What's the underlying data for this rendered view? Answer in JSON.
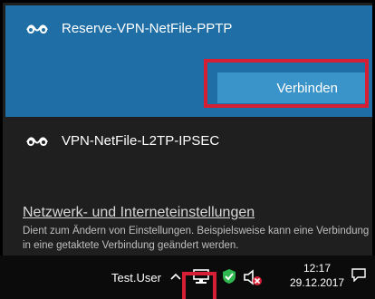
{
  "vpn": {
    "selected": {
      "name": "Reserve-VPN-NetFile-PPTP",
      "connect_label": "Verbinden"
    },
    "items": [
      {
        "name": "VPN-NetFile-L2TP-IPSEC"
      }
    ]
  },
  "settings": {
    "link": "Netzwerk- und Interneteinstellungen",
    "description": "Dient zum Ändern von Einstellungen. Beispielsweise kann eine Verbindung in eine getaktete Verbindung geändert werden."
  },
  "taskbar": {
    "user": "Test.User",
    "time": "12:17",
    "date": "29.12.2017"
  },
  "colors": {
    "accent": "#1f6fa6",
    "button": "#3a94c9",
    "highlight_red": "#d61f35",
    "panel_bg": "#1f1f1f"
  },
  "icons": [
    "vpn-icon",
    "chevron-up-icon",
    "network-icon",
    "defender-shield-icon",
    "volume-muted-icon",
    "notification-icon"
  ]
}
